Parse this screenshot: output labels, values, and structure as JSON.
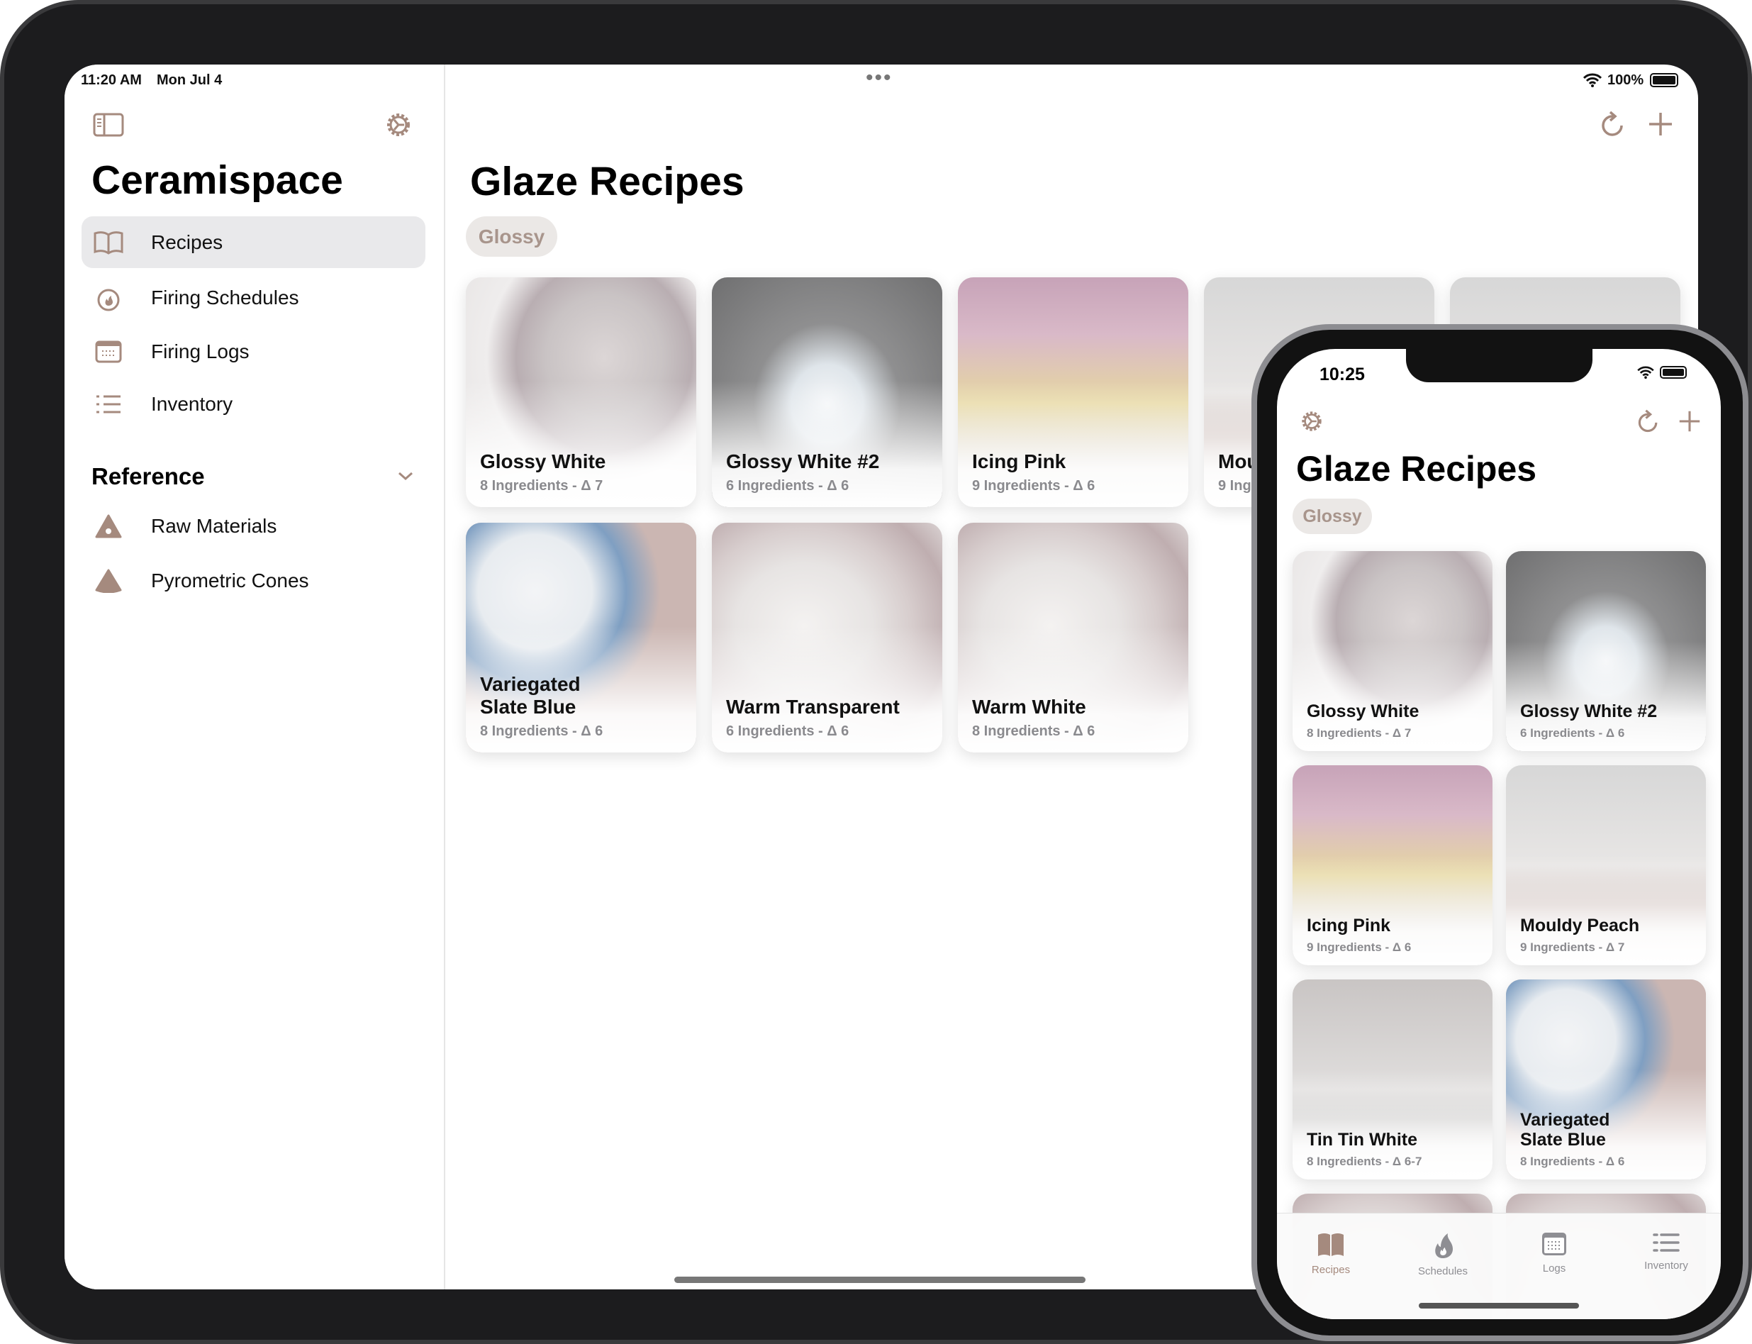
{
  "colors": {
    "accent": "#a58a7e",
    "selected_row": "#e9e9eb",
    "chip_bg": "#ebe8e6",
    "subtitle": "#8a8a8e"
  },
  "ipad": {
    "status": {
      "time": "11:20 AM",
      "date": "Mon Jul 4",
      "battery": "100%",
      "multitask_dots": "•••"
    },
    "sidebar": {
      "toggle_icon": "sidebar-icon",
      "settings_icon": "gear-icon",
      "title": "Ceramispace",
      "items": [
        {
          "label": "Recipes",
          "icon": "book-icon",
          "selected": true
        },
        {
          "label": "Firing Schedules",
          "icon": "flame-icon",
          "selected": false
        },
        {
          "label": "Firing Logs",
          "icon": "calendar-icon",
          "selected": false
        },
        {
          "label": "Inventory",
          "icon": "list-icon",
          "selected": false
        }
      ],
      "section": {
        "label": "Reference",
        "expanded": true,
        "items": [
          {
            "label": "Raw Materials",
            "icon": "raw-materials-icon"
          },
          {
            "label": "Pyrometric Cones",
            "icon": "cone-icon"
          }
        ]
      }
    },
    "main": {
      "title": "Glaze Recipes",
      "filter_chip": "Glossy",
      "cards": [
        {
          "title": "Glossy White",
          "subtitle": "8 Ingredients - Δ 7",
          "image": "white"
        },
        {
          "title": "Glossy White #2",
          "subtitle": "6 Ingredients - Δ 6",
          "image": "mug"
        },
        {
          "title": "Icing Pink",
          "subtitle": "9 Ingredients - Δ 6",
          "image": "pink"
        },
        {
          "title": "Mouldy Peach",
          "subtitle": "9 Ingredients - Δ 7",
          "image": "peach"
        },
        {
          "title": "",
          "subtitle": "",
          "image": "peach"
        },
        {
          "title": "Variegated Slate Blue",
          "subtitle": "8 Ingredients - Δ 6",
          "image": "blue"
        },
        {
          "title": "Warm Transparent",
          "subtitle": "6 Ingredients - Δ 6",
          "image": "cups"
        },
        {
          "title": "Warm White",
          "subtitle": "8 Ingredients - Δ 6",
          "image": "cups"
        }
      ]
    }
  },
  "iphone": {
    "status": {
      "time": "10:25"
    },
    "title": "Glaze Recipes",
    "filter_chip": "Glossy",
    "cards": [
      {
        "title": "Glossy White",
        "subtitle": "8 Ingredients - Δ 7",
        "image": "white"
      },
      {
        "title": "Glossy White #2",
        "subtitle": "6 Ingredients - Δ 6",
        "image": "mug"
      },
      {
        "title": "Icing Pink",
        "subtitle": "9 Ingredients - Δ 6",
        "image": "pink"
      },
      {
        "title": "Mouldy Peach",
        "subtitle": "9 Ingredients - Δ 7",
        "image": "peach"
      },
      {
        "title": "Tin Tin White",
        "subtitle": "8 Ingredients - Δ 6-7",
        "image": "tin"
      },
      {
        "title": "Variegated Slate Blue",
        "subtitle": "8 Ingredients - Δ 6",
        "image": "blue"
      },
      {
        "title": "",
        "subtitle": "",
        "image": "cups"
      },
      {
        "title": "",
        "subtitle": "",
        "image": "cups"
      }
    ],
    "tabs": [
      {
        "label": "Recipes",
        "icon": "book-icon",
        "selected": true
      },
      {
        "label": "Schedules",
        "icon": "flame-icon",
        "selected": false
      },
      {
        "label": "Logs",
        "icon": "calendar-icon",
        "selected": false
      },
      {
        "label": "Inventory",
        "icon": "list-icon",
        "selected": false
      }
    ]
  }
}
